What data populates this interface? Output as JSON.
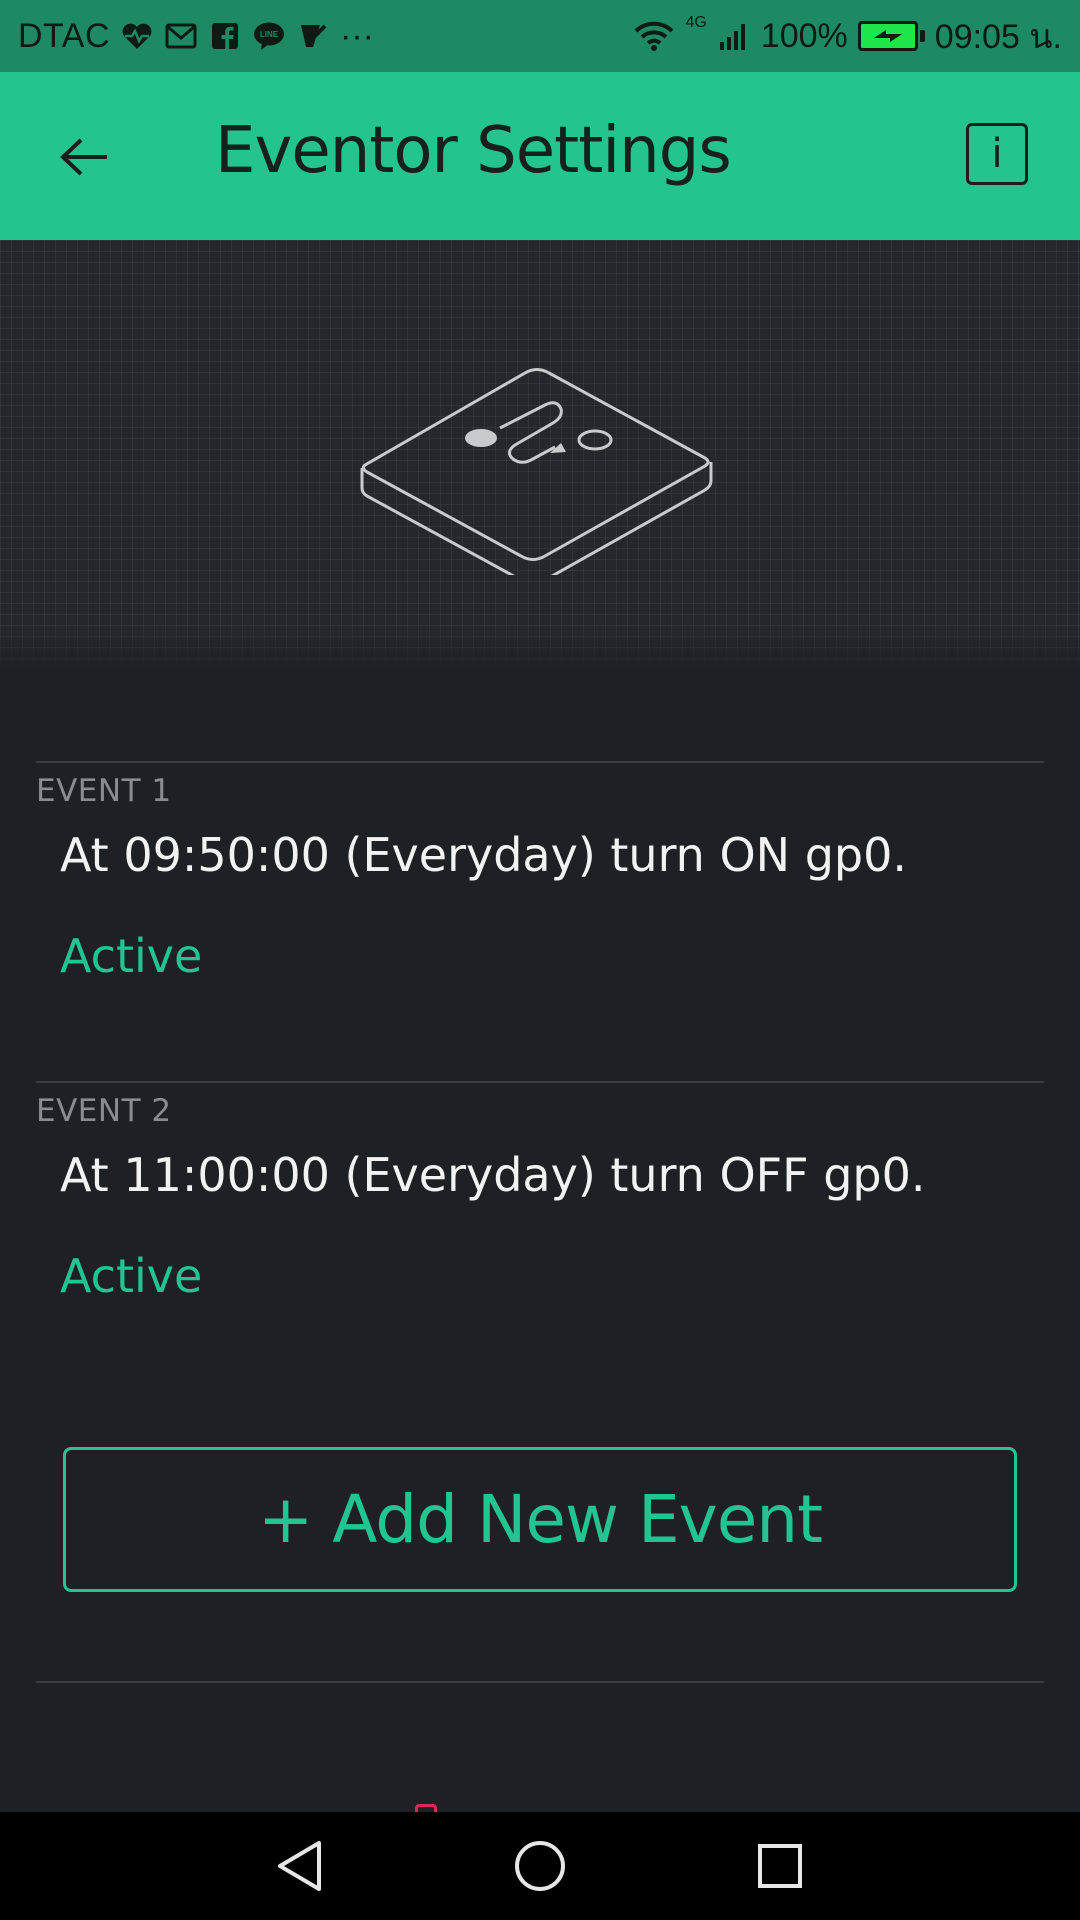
{
  "status_bar": {
    "carrier": "DTAC",
    "notification_icons": [
      "heart-pulse-icon",
      "gmail-icon",
      "facebook-icon",
      "line-icon",
      "check-app-icon"
    ],
    "more": "···",
    "network": "4G",
    "battery_percent": "100%",
    "time": "09:05 น."
  },
  "app_bar": {
    "title": "Eventor Settings",
    "info_label": "i"
  },
  "events": [
    {
      "label": "EVENT 1",
      "description": "At 09:50:00 (Everyday) turn ON gp0.",
      "status": "Active"
    },
    {
      "label": "EVENT 2",
      "description": "At 11:00:00 (Everyday) turn OFF gp0.",
      "status": "Active"
    }
  ],
  "add_button": {
    "label": "+ Add New Event"
  },
  "colors": {
    "accent": "#22c48f",
    "app_bar": "#24c48f",
    "status_bar": "#1d8a65",
    "background": "#1f2023"
  }
}
